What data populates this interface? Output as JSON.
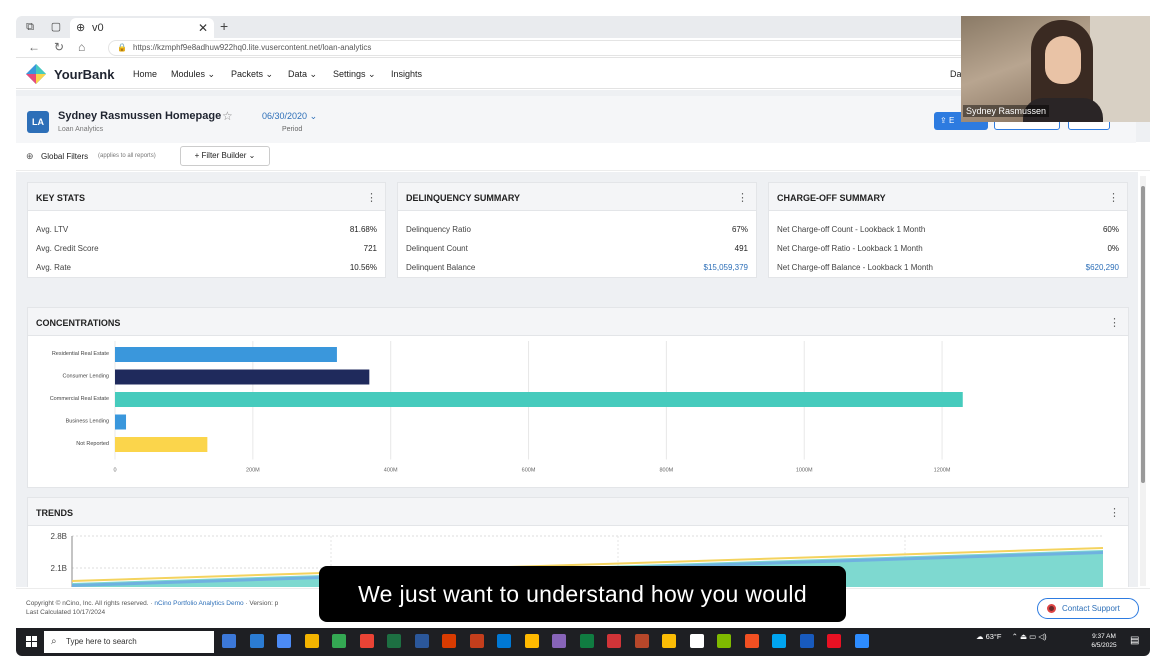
{
  "browser": {
    "tab_title": "v0",
    "url": "https://kzmphf9e8adhuw922hq0.lite.vusercontent.net/loan-analytics"
  },
  "app": {
    "brand": "YourBank",
    "menu": [
      {
        "label": "Home",
        "has_dropdown": false
      },
      {
        "label": "Modules",
        "has_dropdown": true
      },
      {
        "label": "Packets",
        "has_dropdown": true
      },
      {
        "label": "Data",
        "has_dropdown": true
      },
      {
        "label": "Settings",
        "has_dropdown": true
      },
      {
        "label": "Insights",
        "has_dropdown": false
      }
    ],
    "nav_right": "Da"
  },
  "header": {
    "badge": "LA",
    "title": "Sydney Rasmussen Homepage",
    "subtitle": "Loan Analytics",
    "period_date": "06/30/2020",
    "period_label": "Period",
    "export_label": "E"
  },
  "filters": {
    "global_label": "Global Filters",
    "global_note": "(applies to all reports)",
    "builder_label": "+ Filter Builder"
  },
  "key_stats": {
    "title": "KEY STATS",
    "rows": [
      {
        "label": "Avg. LTV",
        "value": "81.68%"
      },
      {
        "label": "Avg. Credit Score",
        "value": "721"
      },
      {
        "label": "Avg. Rate",
        "value": "10.56%"
      }
    ]
  },
  "delinquency": {
    "title": "DELINQUENCY SUMMARY",
    "rows": [
      {
        "label": "Delinquency Ratio",
        "value": "67%"
      },
      {
        "label": "Delinquent Count",
        "value": "491"
      },
      {
        "label": "Delinquent Balance",
        "value": "$15,059,379"
      }
    ]
  },
  "chargeoff": {
    "title": "CHARGE-OFF SUMMARY",
    "rows": [
      {
        "label": "Net Charge-off Count - Lookback 1 Month",
        "value": "60%"
      },
      {
        "label": "Net Charge-off Ratio - Lookback 1 Month",
        "value": "0%"
      },
      {
        "label": "Net Charge-off Balance - Lookback 1 Month",
        "value": "$620,290"
      }
    ]
  },
  "concentrations": {
    "title": "CONCENTRATIONS"
  },
  "trends": {
    "title": "TRENDS"
  },
  "chart_data": [
    {
      "type": "bar",
      "orientation": "horizontal",
      "categories": [
        "Residential Real Estate",
        "Consumer Lending",
        "Commercial Real Estate",
        "Business Lending",
        "Not Reported"
      ],
      "values": [
        322,
        369,
        1230,
        16,
        134
      ],
      "colors": [
        "#3a97dc",
        "#1f2a5c",
        "#46cbbd",
        "#3a97dc",
        "#fbd54b"
      ],
      "x_ticks": [
        "0",
        "200M",
        "400M",
        "600M",
        "800M",
        "1000M",
        "1200M"
      ],
      "xlim": [
        0,
        1300
      ],
      "grid": true
    },
    {
      "type": "area",
      "y_ticks": [
        "2.8B",
        "2.1B"
      ],
      "series_colors": [
        "#7ed9d0",
        "#6fb1e0",
        "#f4d35e"
      ],
      "grid": true
    }
  ],
  "footer": {
    "copyright": "Copyright © nCino, Inc. All rights reserved. ·",
    "demo_link": "nCino Portfolio Analytics Demo",
    "version": "· Version: p",
    "last_calculated": "Last Calculated 10/17/2024",
    "contact": "Contact Support"
  },
  "taskbar": {
    "search_placeholder": "Type here to search",
    "weather": "63°F",
    "time": "9:37 AM",
    "date": "6/5/2025"
  },
  "webcam": {
    "name": "Sydney Rasmussen"
  },
  "caption": "We just want to understand how you would"
}
